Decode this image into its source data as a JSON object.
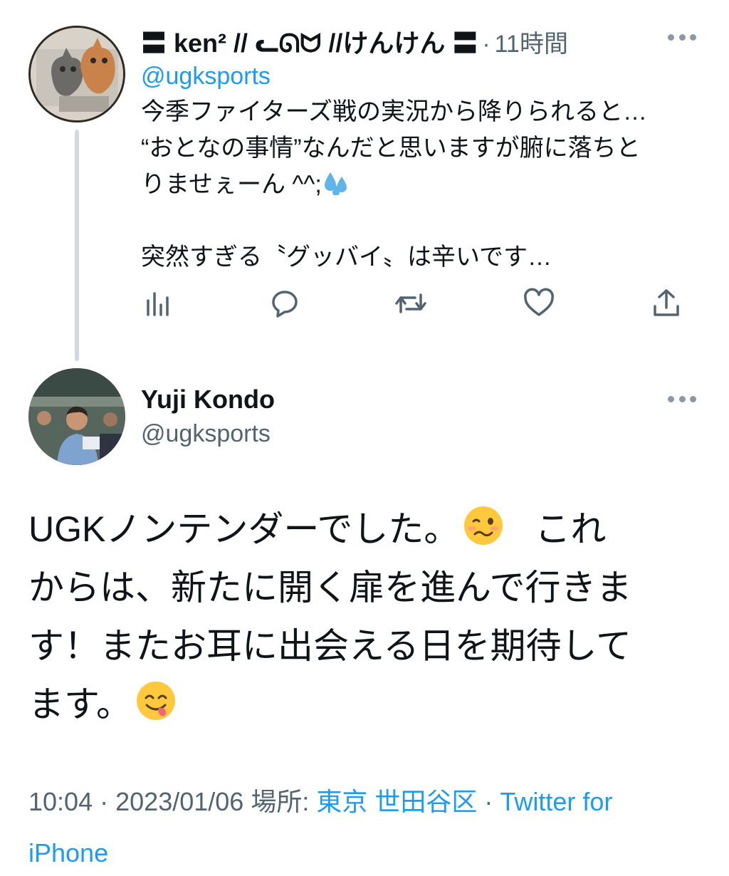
{
  "reply_tweet": {
    "display_name": "〓 ken² // ᓚᘏᗢ //けんけん 〓",
    "separator": "·",
    "time_ago": "11時間",
    "handle": "@ugksports",
    "lines": [
      "今季ファイターズ戦の実況から降りられると…",
      "“おとなの事情”なんだと思いますが腑に落ちと",
      "りませぇーん ^^;"
    ],
    "last_line": "突然すぎる〝グッバイ〟は辛いです…",
    "trailing_emoji": "sweat-droplets-icon",
    "actions": [
      "views-icon",
      "reply-icon",
      "retweet-icon",
      "like-icon",
      "share-icon"
    ]
  },
  "main_tweet": {
    "display_name": "Yuji Kondo",
    "handle": "@ugksports",
    "lines": [
      "UGKノンテンダーでした。",
      "からは、新たに開く扉を進んで行きま",
      "す！またお耳に出会える日を期待して",
      "ます。"
    ],
    "line1_suffix": "これ",
    "emojis": [
      "woozy-face-icon",
      "yum-face-icon"
    ],
    "meta": {
      "time": "10:04",
      "separator": "·",
      "date": "2023/01/06",
      "location_label": "場所:",
      "location": "東京 世田谷区",
      "separator2": "·",
      "client_line1": "Twitter for",
      "client_line2": "iPhone"
    }
  },
  "colors": {
    "accent": "#1d9bf0",
    "text": "#0f1419",
    "secondary": "#536471",
    "thread_line": "#cfd9de"
  }
}
